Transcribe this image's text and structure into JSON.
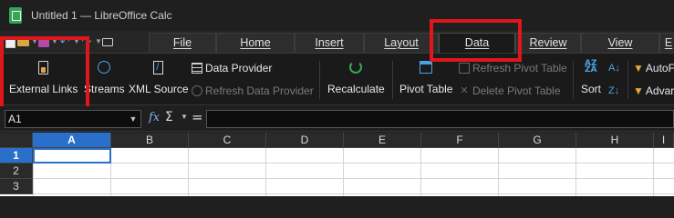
{
  "window": {
    "title": "Untitled 1 — LibreOffice Calc",
    "app_icon": "calc-spreadsheet-icon"
  },
  "quick_access": {
    "icons": [
      "new-document-icon",
      "open-folder-icon",
      "save-icon",
      "undo-icon",
      "redo-icon",
      "print-icon"
    ]
  },
  "tabs": [
    {
      "label": "File"
    },
    {
      "label": "Home"
    },
    {
      "label": "Insert"
    },
    {
      "label": "Layout"
    },
    {
      "label": "Data",
      "active": true
    },
    {
      "label": "Review"
    },
    {
      "label": "View"
    },
    {
      "label": "E"
    }
  ],
  "ribbon": {
    "external_links": "External Links",
    "streams": "Streams",
    "xml_source": "XML Source",
    "data_provider": "Data Provider",
    "refresh_data_provider": "Refresh Data Provider",
    "recalculate": "Recalculate",
    "pivot_table": "Pivot Table",
    "refresh_pivot_table": "Refresh Pivot Table",
    "delete_pivot_table": "Delete Pivot Table",
    "sort": "Sort",
    "autofilter": "AutoF",
    "advanced": "Advar"
  },
  "formula_bar": {
    "name_box": "A1",
    "fx": "fx",
    "sigma": "Σ",
    "equals": "=",
    "formula": ""
  },
  "grid": {
    "columns": [
      "A",
      "B",
      "C",
      "D",
      "E",
      "F",
      "G",
      "H",
      "I"
    ],
    "rows": [
      "1",
      "2",
      "3"
    ],
    "active_cell": "A1"
  },
  "colors": {
    "highlight": "#e0161d",
    "accent": "#2a6fc9",
    "app_green": "#3aa35a"
  }
}
